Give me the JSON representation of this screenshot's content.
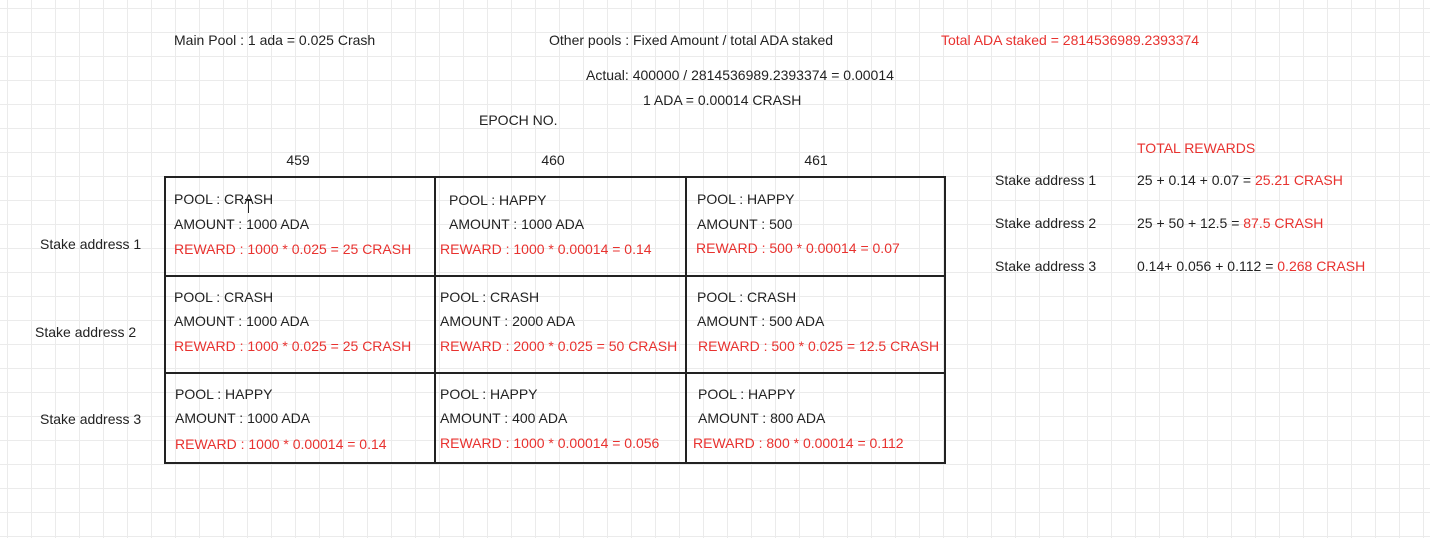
{
  "header": {
    "main_pool": "Main Pool : 1 ada = 0.025 Crash",
    "other_pools": "Other pools : Fixed Amount / total ADA staked",
    "total_ada": "Total ADA staked  = 2814536989.2393374",
    "actual": "Actual: 400000 / 2814536989.2393374 = 0.00014",
    "one_ada": "1 ADA = 0.00014 CRASH",
    "epoch_label": "EPOCH NO."
  },
  "epochs": [
    "459",
    "460",
    "461"
  ],
  "rows": [
    {
      "label": "Stake address 1",
      "cells": [
        {
          "pool": "POOL : CRASH",
          "amount": "AMOUNT : 1000 ADA",
          "reward": "REWARD : 1000 * 0.025 =  25 CRASH"
        },
        {
          "pool": "POOL : HAPPY",
          "amount": "AMOUNT : 1000 ADA",
          "reward": "REWARD : 1000 * 0.00014 = 0.14"
        },
        {
          "pool": "POOL : HAPPY",
          "amount": "AMOUNT : 500",
          "reward": "REWARD : 500 * 0.00014 = 0.07"
        }
      ]
    },
    {
      "label": "Stake address 2",
      "cells": [
        {
          "pool": "POOL : CRASH",
          "amount": "AMOUNT : 1000 ADA",
          "reward": "REWARD : 1000 * 0.025 =  25 CRASH"
        },
        {
          "pool": "POOL : CRASH",
          "amount": "AMOUNT : 2000 ADA",
          "reward": "REWARD : 2000 * 0.025 =  50 CRASH"
        },
        {
          "pool": "POOL : CRASH",
          "amount": "AMOUNT : 500 ADA",
          "reward": "REWARD : 500 * 0.025 =  12.5 CRASH"
        }
      ]
    },
    {
      "label": "Stake address 3",
      "cells": [
        {
          "pool": "POOL : HAPPY",
          "amount": "AMOUNT : 1000 ADA",
          "reward": "REWARD : 1000 * 0.00014 = 0.14"
        },
        {
          "pool": "POOL : HAPPY",
          "amount": "AMOUNT : 400 ADA",
          "reward": "REWARD : 1000 * 0.00014 = 0.056"
        },
        {
          "pool": "POOL : HAPPY",
          "amount": "AMOUNT : 800 ADA",
          "reward": "REWARD : 800 * 0.00014 = 0.112"
        }
      ]
    }
  ],
  "totals": {
    "title": "TOTAL REWARDS",
    "items": [
      {
        "label": "Stake address 1",
        "formula": "25 + 0.14 + 0.07 = ",
        "result": "25.21 CRASH"
      },
      {
        "label": "Stake address 2",
        "formula": "25 + 50 + 12.5 = ",
        "result": "87.5 CRASH"
      },
      {
        "label": "Stake address 3",
        "formula": "0.14+ 0.056 + 0.112 = ",
        "result": "0.268 CRASH"
      }
    ]
  },
  "colors": {
    "accent_red": "#e8322f",
    "text": "#222222",
    "grid_line": "#ebebeb"
  }
}
